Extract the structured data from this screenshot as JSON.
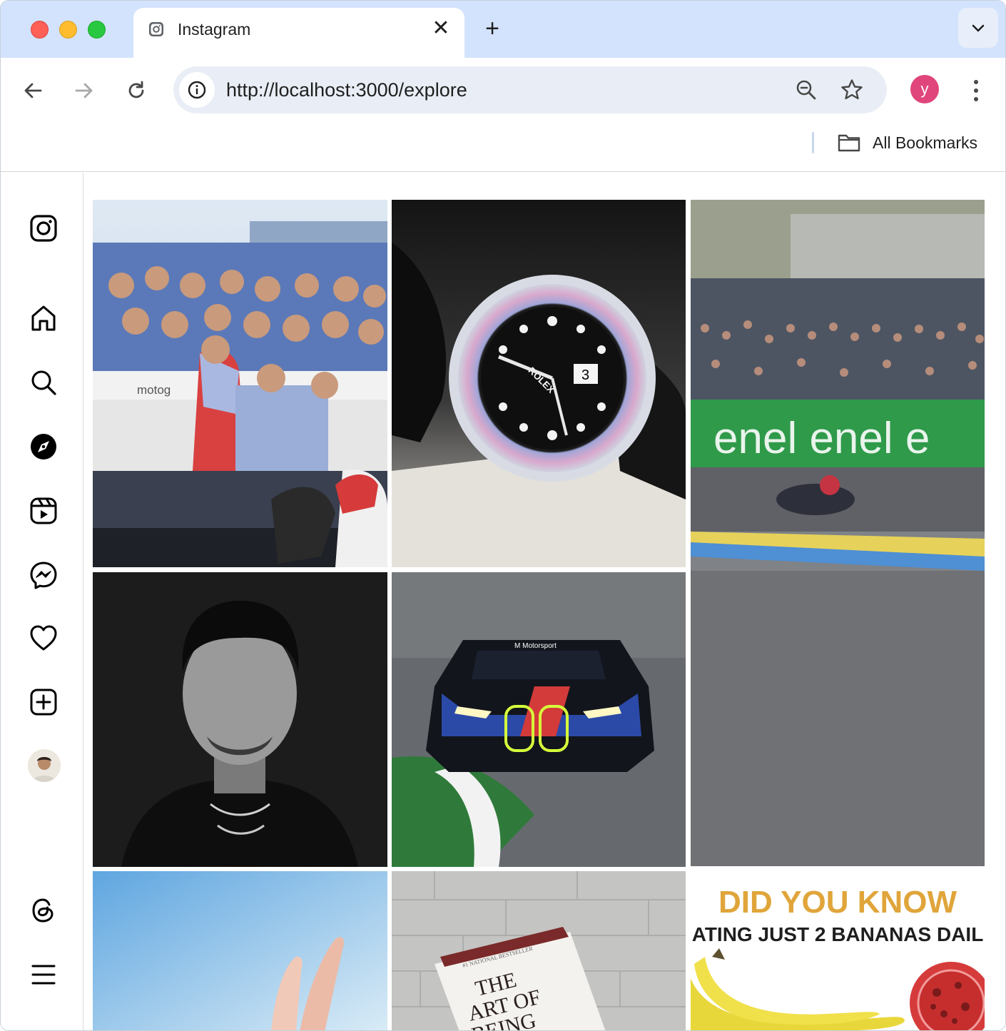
{
  "browser": {
    "tab": {
      "title": "Instagram",
      "close_glyph": "✕"
    },
    "new_tab_glyph": "+",
    "address_bar": {
      "url": "http://localhost:3000/explore"
    },
    "profile_initial": "y",
    "bookmarks": {
      "label": "All Bookmarks"
    }
  },
  "sidebar": {
    "items": [
      {
        "icon": "instagram-logo-icon"
      },
      {
        "icon": "home-icon"
      },
      {
        "icon": "search-icon"
      },
      {
        "icon": "explore-compass-icon"
      },
      {
        "icon": "reels-icon"
      },
      {
        "icon": "messenger-icon"
      },
      {
        "icon": "heart-icon"
      },
      {
        "icon": "create-plus-icon"
      },
      {
        "icon": "profile-avatar"
      },
      {
        "icon": "threads-icon"
      },
      {
        "icon": "menu-icon"
      }
    ]
  },
  "explore": {
    "posts": [
      {
        "subject": "motogp-team-celebration",
        "text": "motog"
      },
      {
        "subject": "rolex-yacht-master-watch",
        "text": "ROLEX"
      },
      {
        "subject": "motogp-race-track-enel",
        "text": "enel enel e"
      },
      {
        "subject": "black-and-white-portrait",
        "text": ""
      },
      {
        "subject": "bmw-m-motorsport-race-car",
        "text": "M Motorsport"
      },
      {
        "subject": "hand-against-sky",
        "text": ""
      },
      {
        "subject": "book-the-art-of-being-alone",
        "text_top": "#1 NATIONAL BESTSELLER",
        "text_title": "THE ART OF BEING"
      },
      {
        "subject": "did-you-know-bananas",
        "headline": "DID YOU KNOW",
        "subline": "ATING JUST 2 BANANAS DAIL"
      }
    ]
  },
  "colors": {
    "tab_strip": "#d3e3fd",
    "omnibox": "#e9eef6",
    "avatar": "#e0457b",
    "banner_green": "#2f9a4a",
    "headline_gold": "#e0a53a"
  }
}
